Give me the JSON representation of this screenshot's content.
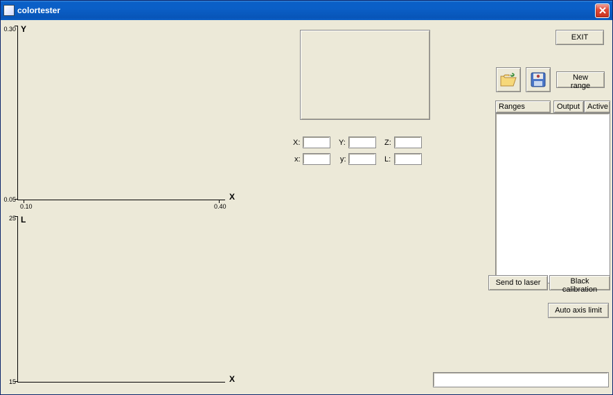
{
  "window": {
    "title": "colortester"
  },
  "buttons": {
    "exit": "EXIT",
    "new_range": "New range",
    "send_to_laser": "Send to laser",
    "black_calibration": "Black calibration",
    "auto_axis_limit": "Auto axis limit"
  },
  "columns": {
    "ranges": "Ranges",
    "output": "Output",
    "active": "Active"
  },
  "fields": {
    "X_label": "X:",
    "Y_label": "Y:",
    "Z_label": "Z:",
    "x_label": "x:",
    "y_label": "y:",
    "L_label": "L:",
    "X": "",
    "Y": "",
    "Z": "",
    "x": "",
    "y": "",
    "L": ""
  },
  "status": "",
  "chart_data": [
    {
      "type": "scatter",
      "title": "",
      "xlabel": "X",
      "ylabel": "Y",
      "xlim": [
        0.1,
        0.4
      ],
      "ylim": [
        0.05,
        0.3
      ],
      "x": [],
      "y": []
    },
    {
      "type": "scatter",
      "title": "",
      "xlabel": "X",
      "ylabel": "L",
      "xlim": [
        0.1,
        0.4
      ],
      "ylim": [
        15.0,
        25.0
      ],
      "x": [],
      "y": []
    }
  ]
}
